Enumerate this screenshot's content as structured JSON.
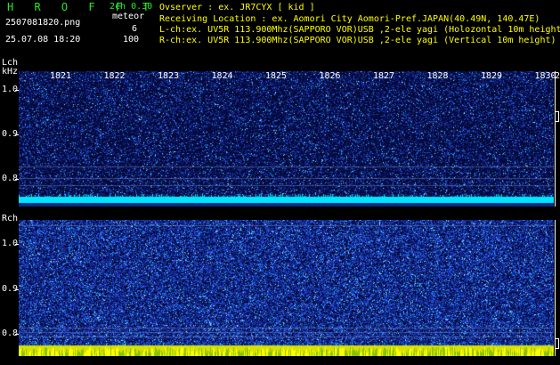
{
  "header": {
    "brand": "H R O F F T",
    "filename": "2507081820.png",
    "timestamp": "25.07.08 18:20",
    "channel_mode": "2ch 0.30",
    "meteor_label": "meteor",
    "meteor_count": "6",
    "threshold": "100",
    "observer_line": "Ovserver          : ex. JR7CYX [ kid ]",
    "location_line": "Receiving Location : ex. Aomori City Aomori-Pref.JAPAN(40.49N, 140.47E)",
    "lch_line": "L-ch:ex. UV5R 113.900Mhz(SAPPORO VOR)USB ,2-ele yagi (Holozontal 10m height)",
    "rch_line": "R-ch:ex. UV5R 113.900Mhz(SAPPORO VOR)USB ,2-ele yagi (Vertical 10m height)"
  },
  "left_panel": {
    "channel": "Lch",
    "unit": "kHz",
    "yticks": [
      "1.0",
      "0.9",
      "0.8"
    ]
  },
  "right_panel": {
    "channel": "Rch",
    "yticks": [
      "1.0",
      "0.9",
      "0.8"
    ]
  },
  "time_axis": {
    "ticks": [
      "1821",
      "1822",
      "1823",
      "1824",
      "1825",
      "1826",
      "1827",
      "1828",
      "1829",
      "1830"
    ],
    "trailing_label": "2"
  },
  "colors": {
    "background": "#000000",
    "header_green": "#29e629",
    "header_yellow": "#ffff00",
    "spectrogram_low": "#050a3a",
    "spectrogram_mid": "#1e3cff",
    "spectrogram_high": "#00ffff",
    "meteor_band": "#00e5ff",
    "rch_bottom_band": "#ffff00"
  }
}
